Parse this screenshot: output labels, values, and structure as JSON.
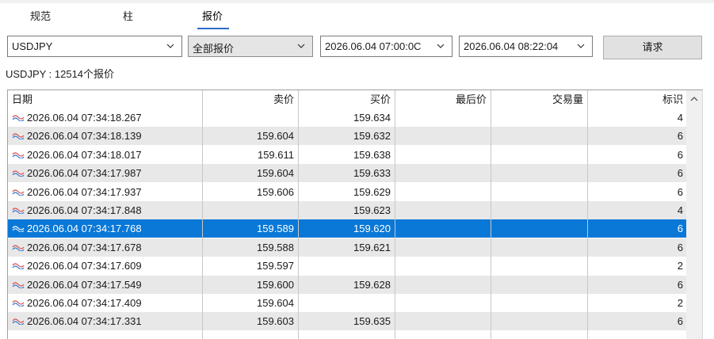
{
  "tabs": [
    "规范",
    "柱",
    "报价"
  ],
  "active_tab": 2,
  "controls": {
    "symbol": "USDJPY",
    "quote_type": "全部报价",
    "from_time": "2026.06.04 07:00:0C",
    "to_time": "2026.06.04 08:22:04",
    "request_label": "请求"
  },
  "summary": "USDJPY : 12514个报价",
  "table": {
    "columns": [
      "日期",
      "卖价",
      "买价",
      "最后价",
      "交易量",
      "标识"
    ],
    "selected_row": 6,
    "rows": [
      {
        "date": "2026.06.04 07:34:18.267",
        "bid": "",
        "ask": "159.634",
        "last": "",
        "volume": "",
        "flag": "4"
      },
      {
        "date": "2026.06.04 07:34:18.139",
        "bid": "159.604",
        "ask": "159.632",
        "last": "",
        "volume": "",
        "flag": "6"
      },
      {
        "date": "2026.06.04 07:34:18.017",
        "bid": "159.611",
        "ask": "159.638",
        "last": "",
        "volume": "",
        "flag": "6"
      },
      {
        "date": "2026.06.04 07:34:17.987",
        "bid": "159.604",
        "ask": "159.633",
        "last": "",
        "volume": "",
        "flag": "6"
      },
      {
        "date": "2026.06.04 07:34:17.937",
        "bid": "159.606",
        "ask": "159.629",
        "last": "",
        "volume": "",
        "flag": "6"
      },
      {
        "date": "2026.06.04 07:34:17.848",
        "bid": "",
        "ask": "159.623",
        "last": "",
        "volume": "",
        "flag": "4"
      },
      {
        "date": "2026.06.04 07:34:17.768",
        "bid": "159.589",
        "ask": "159.620",
        "last": "",
        "volume": "",
        "flag": "6"
      },
      {
        "date": "2026.06.04 07:34:17.678",
        "bid": "159.588",
        "ask": "159.621",
        "last": "",
        "volume": "",
        "flag": "6"
      },
      {
        "date": "2026.06.04 07:34:17.609",
        "bid": "159.597",
        "ask": "",
        "last": "",
        "volume": "",
        "flag": "2"
      },
      {
        "date": "2026.06.04 07:34:17.549",
        "bid": "159.600",
        "ask": "159.628",
        "last": "",
        "volume": "",
        "flag": "6"
      },
      {
        "date": "2026.06.04 07:34:17.409",
        "bid": "159.604",
        "ask": "",
        "last": "",
        "volume": "",
        "flag": "2"
      },
      {
        "date": "2026.06.04 07:34:17.331",
        "bid": "159.603",
        "ask": "159.635",
        "last": "",
        "volume": "",
        "flag": "6"
      }
    ]
  },
  "icons": {
    "row_icon": "tick-wave-icon",
    "dropdown": "chevron-down-icon",
    "scroll_up": "scroll-up-arrow-icon"
  },
  "colors": {
    "selection": "#0a78d7",
    "alt_row": "#e8e8e8",
    "wave_red": "#d9534f",
    "wave_blue": "#3a7bd5"
  }
}
